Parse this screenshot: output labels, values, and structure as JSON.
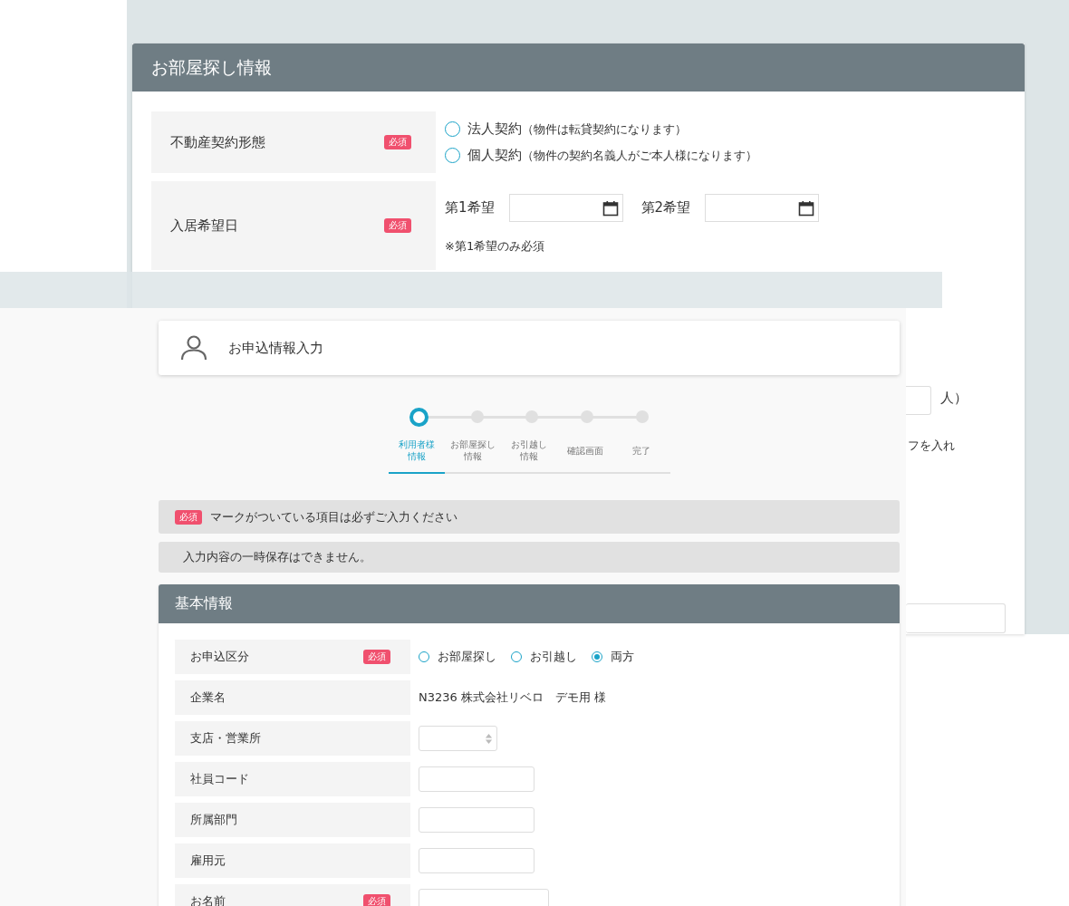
{
  "back_window": {
    "title": "お部屋探し情報",
    "rows": [
      {
        "kind": "radio",
        "label": "不動産契約形態",
        "badge": "必須",
        "options": [
          {
            "label": "法人契約",
            "note": "（物件は転貸契約になります）",
            "selected": false
          },
          {
            "label": "個人契約",
            "note": "（物件の契約名義人がご本人様になります）",
            "selected": false
          }
        ]
      },
      {
        "kind": "dates",
        "label": "入居希望日",
        "badge": "必須",
        "fields": [
          {
            "label": "第1希望"
          },
          {
            "label": "第2希望"
          }
        ],
        "note": "※第1希望のみ必須"
      }
    ],
    "partial_texts": [
      "人）",
      "フを入れ"
    ]
  },
  "front_window": {
    "title": "お申込情報入力",
    "steps": [
      {
        "label_lines": [
          "利用者様",
          "情報"
        ],
        "selected": true
      },
      {
        "label_lines": [
          "お部屋探し",
          "情報"
        ],
        "selected": false
      },
      {
        "label_lines": [
          "お引越し",
          "情報"
        ],
        "selected": false
      },
      {
        "label_lines": [
          "確認画面"
        ],
        "selected": false
      },
      {
        "label_lines": [
          "完了"
        ],
        "selected": false
      }
    ],
    "notices": [
      {
        "badge": "必須",
        "text": "マークがついている項目は必ずご入力ください"
      },
      {
        "text": "入力内容の一時保存はできません。"
      }
    ],
    "section": {
      "title": "基本情報",
      "rows": [
        {
          "kind": "radio",
          "label": "お申込区分",
          "badge": "必須",
          "options": [
            {
              "label": "お部屋探し",
              "selected": false
            },
            {
              "label": "お引越し",
              "selected": false
            },
            {
              "label": "両方",
              "selected": true
            }
          ]
        },
        {
          "kind": "text",
          "label": "企業名",
          "value": "N3236 株式会社リベロ　デモ用 様"
        },
        {
          "kind": "select",
          "label": "支店・営業所"
        },
        {
          "kind": "input",
          "label": "社員コード"
        },
        {
          "kind": "input",
          "label": "所属部門"
        },
        {
          "kind": "input",
          "label": "雇用元"
        },
        {
          "kind": "input_wide",
          "label": "お名前",
          "badge": "必須"
        }
      ]
    }
  }
}
